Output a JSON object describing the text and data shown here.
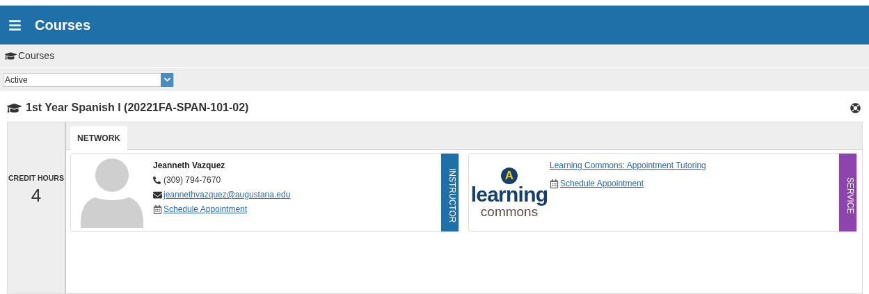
{
  "header": {
    "title": "Courses"
  },
  "breadcrumb": {
    "label": "Courses"
  },
  "filter": {
    "value": "Active"
  },
  "course": {
    "title": "1st Year Spanish I (20221FA-SPAN-101-02)"
  },
  "credit_hours": {
    "label": "CREDIT HOURS",
    "value": "4"
  },
  "tabs": [
    {
      "label": "NETWORK",
      "selected": true
    }
  ],
  "cards": [
    {
      "kind": "person",
      "name": "Jeanneth Vazquez",
      "phone": "(309) 794-7670",
      "email": "jeannethvazquez@augustana.edu",
      "link": "Schedule Appointment",
      "tag": "INSTRUCTOR",
      "color": "#1f6fa8"
    },
    {
      "kind": "service",
      "logo": {
        "letter": "A",
        "line1": "learning",
        "line2": "commons"
      },
      "name": "Learning Commons: Appointment Tutoring",
      "link": "Schedule Appointment",
      "tag": "SERVICE",
      "color": "#8e44ad"
    }
  ]
}
